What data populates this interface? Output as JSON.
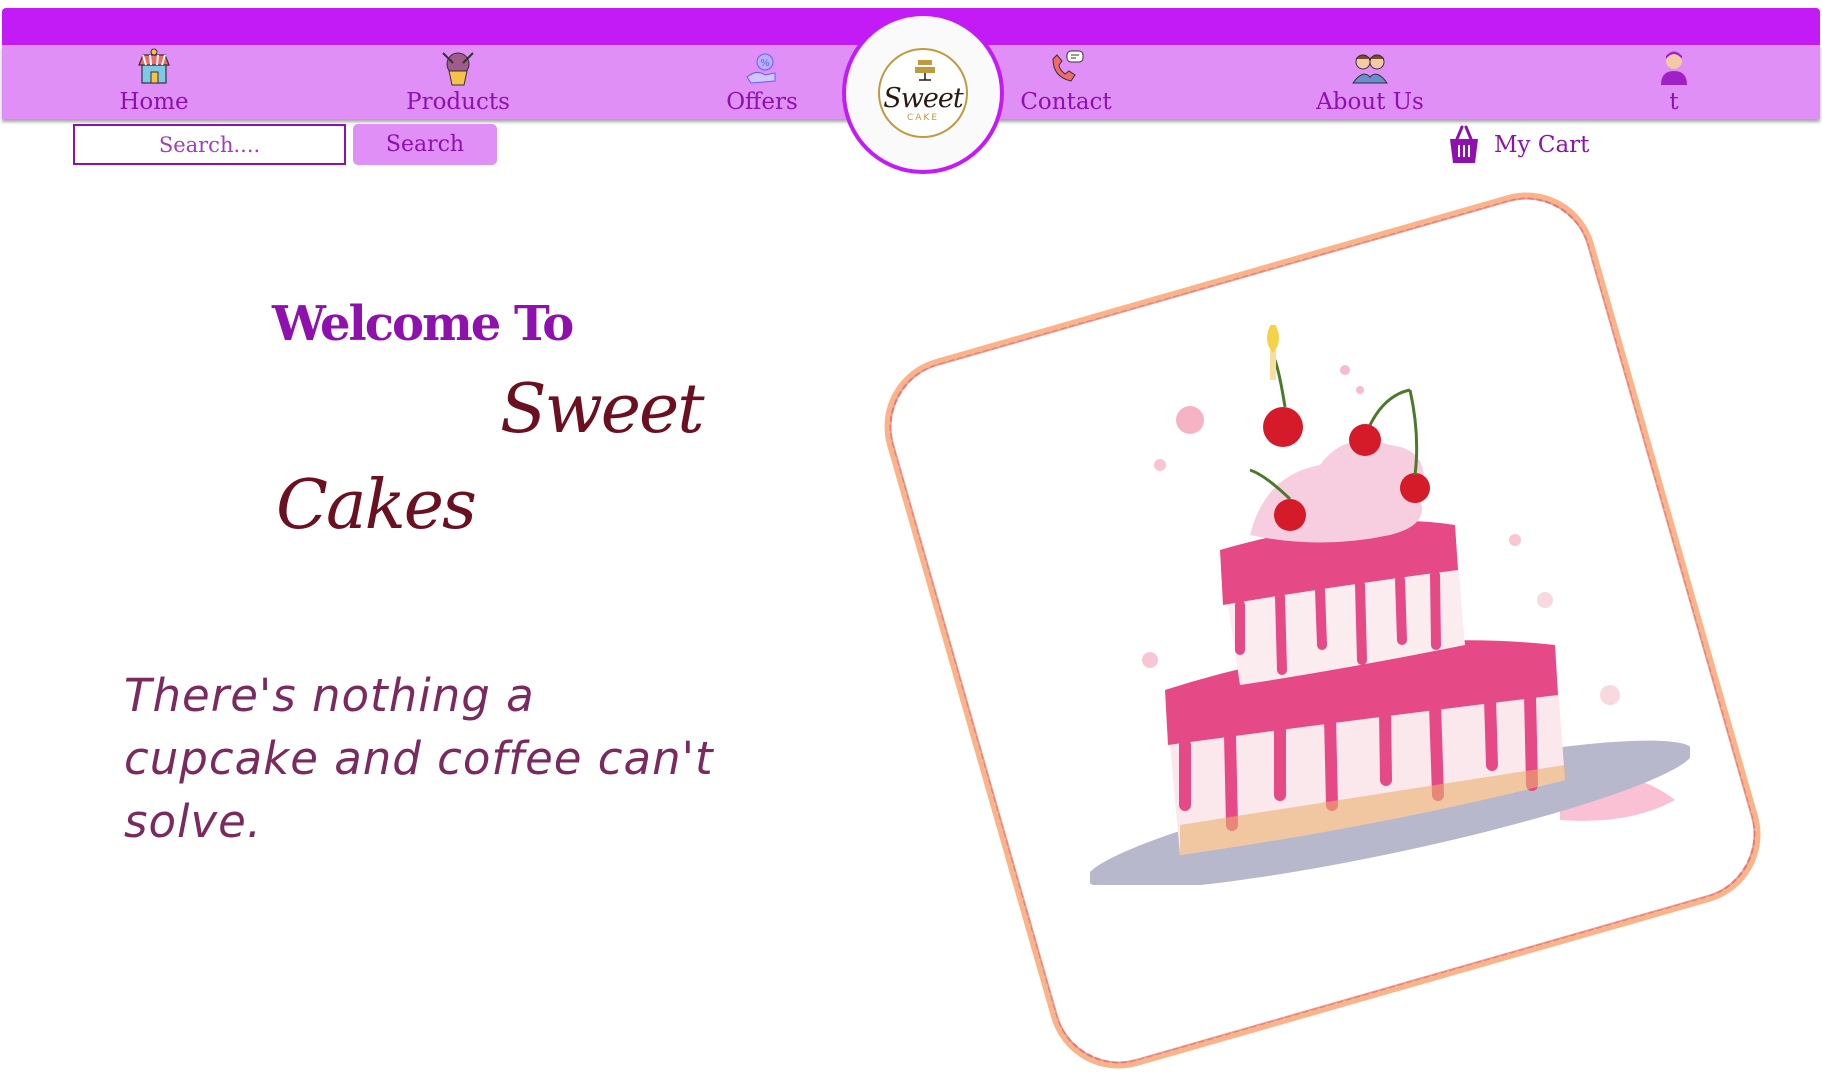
{
  "nav": {
    "items": [
      {
        "label": "Home",
        "icon": "storefront-icon"
      },
      {
        "label": "Products",
        "icon": "cupcake-icon"
      },
      {
        "label": "Offers",
        "icon": "offer-hand-icon"
      },
      {
        "label": "Contact",
        "icon": "phone-chat-icon"
      },
      {
        "label": "About Us",
        "icon": "team-icon"
      },
      {
        "label": "t",
        "icon": "user-icon"
      }
    ],
    "logo": {
      "word": "Sweet",
      "sub": "CAKE"
    }
  },
  "search": {
    "placeholder": "Search....",
    "button_label": "Search"
  },
  "cart": {
    "label": "My Cart",
    "icon": "basket-icon"
  },
  "hero": {
    "welcome": "Welcome To",
    "line1": "Sweet",
    "line2": "Cakes",
    "tagline": "There's nothing a cupcake and coffee can't solve.",
    "image": "tiered-cake-illustration"
  },
  "colors": {
    "accent": "#c31bf5",
    "nav_bg": "#df8ff6",
    "text_purple": "#8e10ad",
    "title_maroon": "#6a1020",
    "frame": "#fbb38a"
  }
}
